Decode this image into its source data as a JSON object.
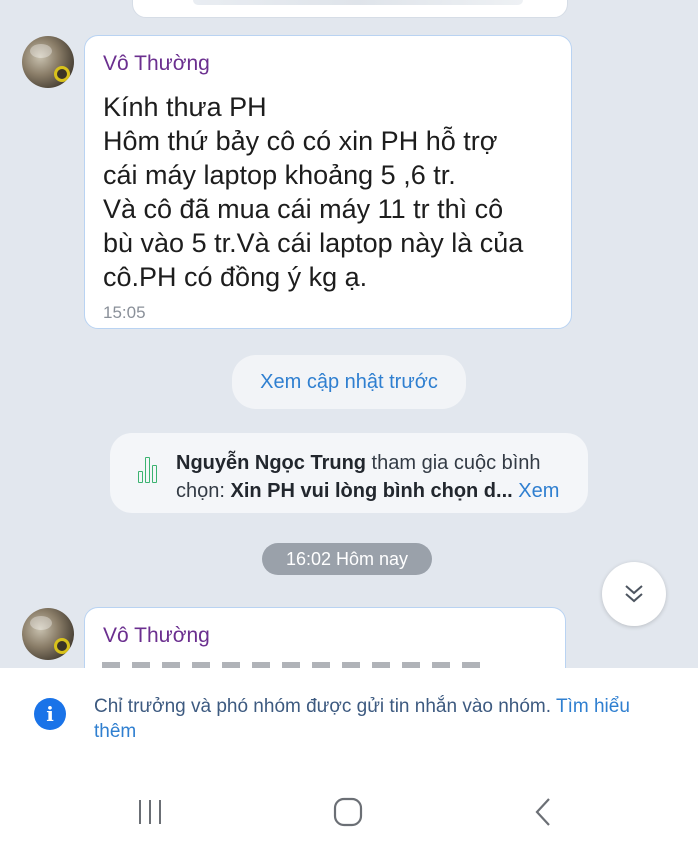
{
  "messages": [
    {
      "sender": "Vô Thường",
      "lines": [
        "Kính thưa PH",
        "Hôm thứ bảy cô có xin PH hỗ trợ",
        "cái máy laptop khoảng 5 ,6 tr.",
        "Và cô đã mua cái máy 11 tr thì cô",
        "bù vào 5 tr.Và cái laptop này là của",
        "cô.PH có đồng ý kg ạ."
      ],
      "time": "15:05"
    },
    {
      "sender": "Vô Thường"
    }
  ],
  "load_previous": "Xem cập nhật trước",
  "poll_event": {
    "actor": "Nguyễn Ngọc Trung",
    "action": " tham gia cuộc bình chọn: ",
    "poll_title": "Xin PH vui lòng bình chọn d...",
    "more": " Xem"
  },
  "date_separator": "16:02 Hôm nay",
  "notice": {
    "text": "Chỉ trưởng và phó nhóm được gửi tin nhắn vào nhóm. ",
    "link": "Tìm hiểu thêm"
  },
  "icons": {
    "info": "info-icon",
    "poll": "poll-icon",
    "scroll_down": "double-chevron-down-icon",
    "nav_recents": "recents-icon",
    "nav_home": "home-icon",
    "nav_back": "back-icon"
  },
  "colors": {
    "sender": "#6b2f8f",
    "link": "#2f7fd0",
    "chat_background": "#e2e7ee",
    "info_icon": "#1a73e8",
    "poll_icon": "#3cb371"
  }
}
